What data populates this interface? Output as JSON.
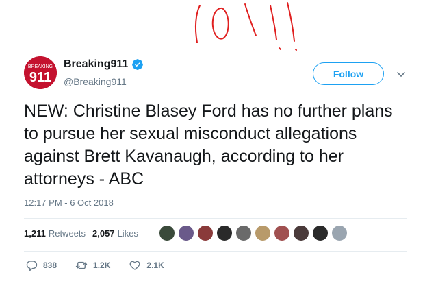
{
  "annotation": {
    "color": "#e02020"
  },
  "tweet": {
    "avatar": {
      "icon": "breaking911-logo",
      "text_top": "BREAKING",
      "text_main": "911",
      "color": "#c4122f"
    },
    "display_name": "Breaking911",
    "handle": "@Breaking911",
    "verified": true,
    "follow_label": "Follow",
    "text": "NEW: Christine Blasey Ford has no further plans to pursue her sexual misconduct allegations against Brett Kavanaugh, according to her attorneys - ABC",
    "timestamp": "12:17 PM - 6 Oct 2018",
    "stats": {
      "retweets_count": "1,211",
      "retweets_label": "Retweets",
      "likes_count": "2,057",
      "likes_label": "Likes"
    },
    "liker_avatars": [
      "#3a4a3a",
      "#6a5a8a",
      "#8a3a3a",
      "#2a2a2a",
      "#6a6a6a",
      "#b89a6a",
      "#a05050",
      "#4a3a3a",
      "#2a2a2a",
      "#9aa5b0"
    ],
    "actions": {
      "replies": "838",
      "retweets": "1.2K",
      "likes": "2.1K"
    }
  },
  "colors": {
    "accent": "#1da1f2",
    "muted": "#657786",
    "text": "#14171a"
  }
}
